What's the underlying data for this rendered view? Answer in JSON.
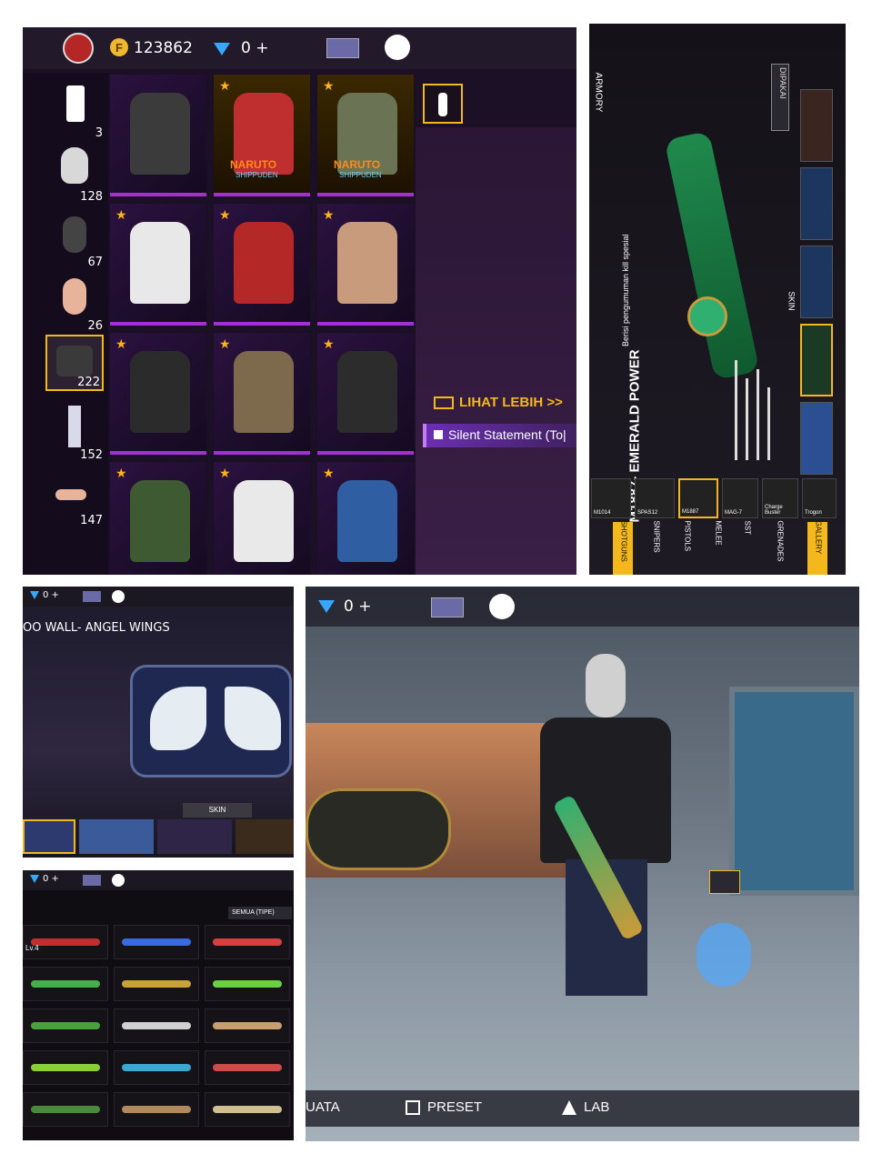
{
  "panel_a": {
    "coins": "123862",
    "diamonds": "0 +",
    "categories": [
      {
        "icon": "outfit-icon",
        "count": "3"
      },
      {
        "icon": "hair-icon",
        "count": "128"
      },
      {
        "icon": "mask-icon",
        "count": "67"
      },
      {
        "icon": "face-icon",
        "count": "26"
      },
      {
        "icon": "jacket-icon",
        "count": "222"
      },
      {
        "icon": "pants-icon",
        "count": "152"
      },
      {
        "icon": "shoes-icon",
        "count": "147"
      }
    ],
    "grid": [
      {
        "label": "",
        "badge": "",
        "star": false,
        "color": "#3b3b3b"
      },
      {
        "label": "NARUTO",
        "badge": "SHIPPUDEN",
        "star": true,
        "color": "#c02f2f"
      },
      {
        "label": "NARUTO",
        "badge": "SHIPPUDEN",
        "star": true,
        "color": "#6a7354"
      },
      {
        "label": "",
        "badge": "",
        "star": true,
        "color": "#e8e8e8"
      },
      {
        "label": "",
        "badge": "",
        "star": true,
        "color": "#b52828"
      },
      {
        "label": "",
        "badge": "",
        "star": true,
        "color": "#c79b7b"
      },
      {
        "label": "",
        "badge": "",
        "star": true,
        "color": "#2b2b2b"
      },
      {
        "label": "",
        "badge": "",
        "star": true,
        "color": "#7d6a4d"
      },
      {
        "label": "",
        "badge": "",
        "star": true,
        "color": "#2c2c2c"
      },
      {
        "label": "",
        "badge": "",
        "star": true,
        "color": "#3e5a33"
      },
      {
        "label": "",
        "badge": "",
        "star": true,
        "color": "#e9e9e9"
      },
      {
        "label": "",
        "badge": "",
        "star": true,
        "color": "#2f5ea3"
      }
    ],
    "see_more": "LIHAT LEBIH >>",
    "selected_item": "Silent Statement (To|"
  },
  "panel_b": {
    "armory": "ARMORY",
    "weapon_name": "M1887- EMERALD POWER",
    "special": "Berisi pengumuman kill spesial",
    "equipped": "DIPAKAI",
    "skin": "SKIN",
    "weapons": [
      "M1014",
      "SPAS12",
      "M1887",
      "MAG-7",
      "Charge Buster",
      "Trogon"
    ],
    "tabs": [
      "SHOTGUNS",
      "SNIPERS",
      "PISTOLS",
      "MELEE",
      "SST",
      "GRENADES",
      "GALLERY"
    ]
  },
  "panel_c": {
    "diamonds": "0 +",
    "title": "OO WALL- ANGEL WINGS",
    "skin": "SKIN"
  },
  "panel_d": {
    "diamonds": "0 +",
    "filter": "SEMUA (TIPE)",
    "badge": "Lv.4"
  },
  "panel_e": {
    "diamonds": "0 +",
    "bottom": [
      "UATA",
      "PRESET",
      "LAB"
    ]
  },
  "colors": {
    "purple": "#a32fd6",
    "gold": "#ffb21a",
    "dark": "#16101d",
    "accent_blue": "#35a7ff"
  }
}
